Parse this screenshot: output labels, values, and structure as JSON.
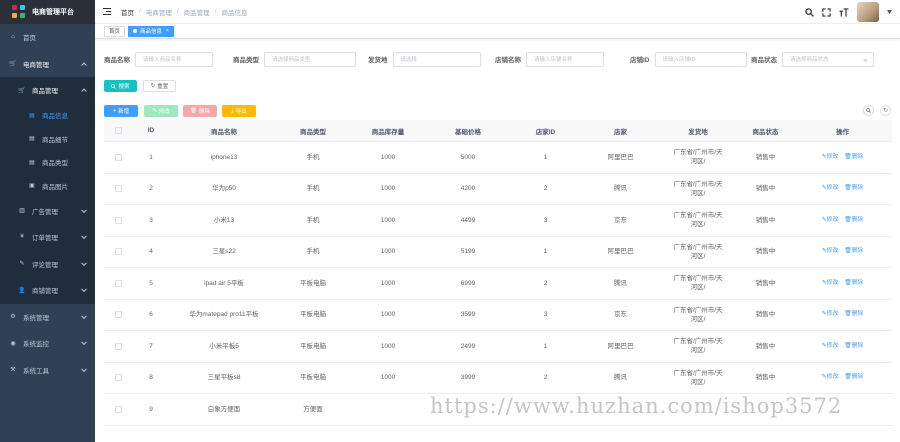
{
  "app": {
    "title": "电商管理平台"
  },
  "sidebar": {
    "items": [
      {
        "label": "首页",
        "icon": "dashboard-icon"
      },
      {
        "label": "电商管理",
        "icon": "cart-icon"
      },
      {
        "label": "商品管理",
        "icon": "cart-icon"
      },
      {
        "label": "商品信息",
        "icon": "list-icon"
      },
      {
        "label": "商品细节",
        "icon": "list-icon"
      },
      {
        "label": "商品类型",
        "icon": "list-icon"
      },
      {
        "label": "商品图片",
        "icon": "image-icon"
      },
      {
        "label": "广告管理",
        "icon": "ad-icon"
      },
      {
        "label": "订单管理",
        "icon": "yen-icon"
      },
      {
        "label": "评论管理",
        "icon": "edit-icon"
      },
      {
        "label": "商铺管理",
        "icon": "user-icon"
      },
      {
        "label": "系统管理",
        "icon": "system-icon"
      },
      {
        "label": "系统监控",
        "icon": "monitor-icon"
      },
      {
        "label": "系统工具",
        "icon": "tool-icon"
      }
    ]
  },
  "navbar": {
    "breadcrumb": [
      "首页",
      "电商管理",
      "商品管理",
      "商品信息"
    ]
  },
  "tags": [
    "首页",
    "商品信息"
  ],
  "search": {
    "fields": [
      {
        "label": "商品名称",
        "placeholder": "请输入商品名称"
      },
      {
        "label": "商品类型",
        "placeholder": "请选择商品类型"
      },
      {
        "label": "发货地",
        "placeholder": "请选择"
      },
      {
        "label": "店铺名称",
        "placeholder": "请输入店铺名称"
      },
      {
        "label": "店铺ID",
        "placeholder": "请输入店铺ID"
      },
      {
        "label": "商品状态",
        "placeholder": "请选择商品状态"
      }
    ],
    "search_label": "搜索",
    "reset_label": "重置"
  },
  "toolbar": {
    "add": "新增",
    "edit": "修改",
    "delete": "删除",
    "export": "导出"
  },
  "table": {
    "columns": [
      "ID",
      "商品名称",
      "商品类型",
      "商品库存量",
      "基础价格",
      "店家ID",
      "店家",
      "发货地",
      "商品状态",
      "操作"
    ],
    "edit_label": "修改",
    "delete_label": "删除",
    "rows": [
      {
        "id": "1",
        "name": "iphone13",
        "type": "手机",
        "stock": "1000",
        "price": "5000",
        "shop_id": "1",
        "shop": "阿里巴巴",
        "origin": "广东省/广州市/天河区/",
        "status": "销售中"
      },
      {
        "id": "2",
        "name": "华为p50",
        "type": "手机",
        "stock": "1000",
        "price": "4200",
        "shop_id": "2",
        "shop": "腾讯",
        "origin": "广东省/广州市/天河区/",
        "status": "销售中"
      },
      {
        "id": "3",
        "name": "小米13",
        "type": "手机",
        "stock": "1000",
        "price": "4499",
        "shop_id": "3",
        "shop": "京东",
        "origin": "广东省/广州市/天河区/",
        "status": "销售中"
      },
      {
        "id": "4",
        "name": "三星s22",
        "type": "手机",
        "stock": "1000",
        "price": "5199",
        "shop_id": "1",
        "shop": "阿里巴巴",
        "origin": "广东省/广州市/天河区/",
        "status": "销售中"
      },
      {
        "id": "5",
        "name": "ipad air 5平板",
        "type": "平板电脑",
        "stock": "1000",
        "price": "6999",
        "shop_id": "2",
        "shop": "腾讯",
        "origin": "广东省/广州市/天河区/",
        "status": "销售中"
      },
      {
        "id": "6",
        "name": "华为matepad pro11平板",
        "type": "平板电脑",
        "stock": "1000",
        "price": "3599",
        "shop_id": "3",
        "shop": "京东",
        "origin": "广东省/广州市/天河区/",
        "status": "销售中"
      },
      {
        "id": "7",
        "name": "小米平板5",
        "type": "平板电脑",
        "stock": "1000",
        "price": "2499",
        "shop_id": "1",
        "shop": "阿里巴巴",
        "origin": "广东省/广州市/天河区/",
        "status": "销售中"
      },
      {
        "id": "8",
        "name": "三星平板s8",
        "type": "平板电脑",
        "stock": "1000",
        "price": "3999",
        "shop_id": "2",
        "shop": "腾讯",
        "origin": "广东省/广州市/天河区/",
        "status": "销售中"
      },
      {
        "id": "9",
        "name": "白象方便面",
        "type": "方便面",
        "stock": "",
        "price": "",
        "shop_id": "",
        "shop": "",
        "origin": "",
        "status": ""
      }
    ]
  },
  "watermark": "https://www.huzhan.com/ishop3572",
  "colors": {
    "primary": "#409eff",
    "success": "#13ce66",
    "danger": "#ff4949",
    "warning": "#ffba00",
    "cyan": "#13c2c2",
    "sidebar_bg": "#304156"
  }
}
